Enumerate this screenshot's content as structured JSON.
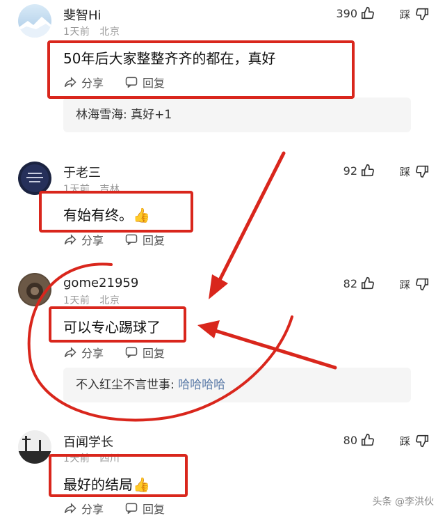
{
  "comments": [
    {
      "username": "斐智Hi",
      "time": "1天前",
      "location": "北京",
      "likes": "390",
      "dislike_label": "踩",
      "text": "50年后大家整整齐齐的都在，真好",
      "share_label": "分享",
      "reply_label": "回复",
      "reply": {
        "name": "林海雪海:",
        "text": "真好+1"
      }
    },
    {
      "username": "于老三",
      "time": "1天前",
      "location": "吉林",
      "likes": "92",
      "dislike_label": "踩",
      "text": "有始有终。👍",
      "share_label": "分享",
      "reply_label": "回复"
    },
    {
      "username": "gome21959",
      "time": "1天前",
      "location": "北京",
      "likes": "82",
      "dislike_label": "踩",
      "text": "可以专心踢球了",
      "share_label": "分享",
      "reply_label": "回复",
      "reply": {
        "name": "不入红尘不言世事:",
        "text": "哈哈哈哈"
      }
    },
    {
      "username": "百闻学长",
      "time": "1天前",
      "location": "四川",
      "likes": "80",
      "dislike_label": "踩",
      "text": "最好的结局👍",
      "share_label": "分享",
      "reply_label": "回复"
    }
  ],
  "watermark": "头条 @李洪伙",
  "colors": {
    "highlight": "#d9261c",
    "reply_name_blue": "#5b7ba8"
  },
  "icons": [
    "thumb-up-icon",
    "thumb-down-icon",
    "share-icon",
    "reply-icon"
  ]
}
